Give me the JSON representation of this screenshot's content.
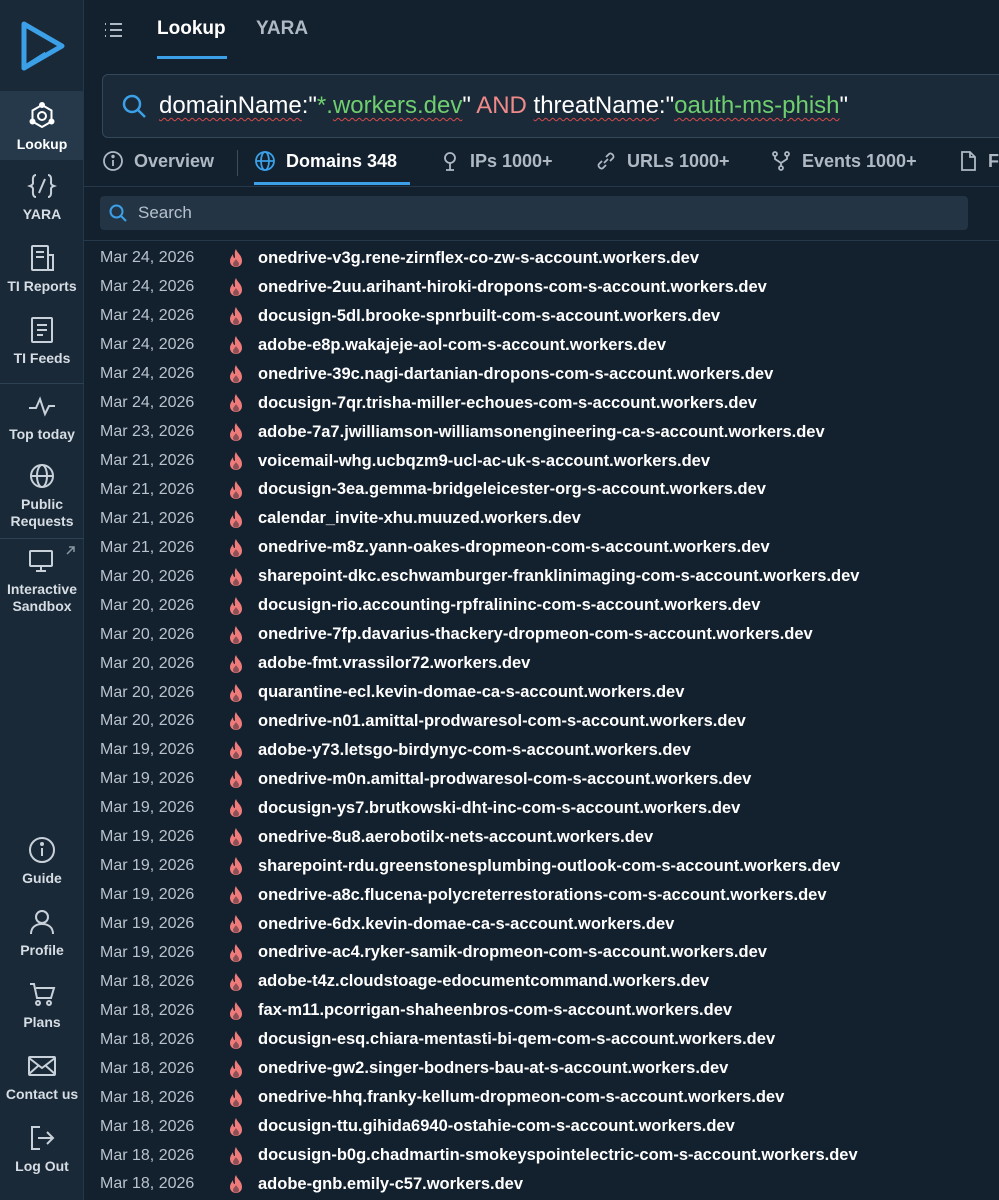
{
  "sidebar": {
    "items": [
      {
        "label": "Lookup",
        "icon": "network-hexagon-icon"
      },
      {
        "label": "YARA",
        "icon": "braces-icon"
      },
      {
        "label": "TI Reports",
        "icon": "report-icon"
      },
      {
        "label": "TI Feeds",
        "icon": "feed-icon"
      },
      {
        "label": "Top today",
        "icon": "pulse-icon"
      },
      {
        "label": "Public Requests",
        "icon": "globe-icon"
      },
      {
        "label": "Interactive Sandbox",
        "icon": "monitor-icon"
      }
    ],
    "bottom_items": [
      {
        "label": "Guide",
        "icon": "info-icon"
      },
      {
        "label": "Profile",
        "icon": "user-icon"
      },
      {
        "label": "Plans",
        "icon": "cart-icon"
      },
      {
        "label": "Contact us",
        "icon": "envelope-icon"
      },
      {
        "label": "Log Out",
        "icon": "logout-icon"
      }
    ]
  },
  "top_tabs": [
    {
      "label": "Lookup",
      "active": true
    },
    {
      "label": "YARA",
      "active": false
    }
  ],
  "query": {
    "field1": "domainName",
    "colon1": ":\"",
    "wildcard": "*.",
    "value1": "workers.dev",
    "close1": "\" ",
    "operator": "AND",
    "space": " ",
    "field2": "threatName",
    "colon2": ":\"",
    "value2": "oauth-ms-phish",
    "close2": "\""
  },
  "result_tabs": [
    {
      "label": "Overview",
      "icon": "info-circle-icon"
    },
    {
      "label": "Domains 348",
      "icon": "globe-icon",
      "active": true
    },
    {
      "label": "IPs 1000+",
      "icon": "location-pin-icon"
    },
    {
      "label": "URLs 1000+",
      "icon": "link-icon"
    },
    {
      "label": "Events 1000+",
      "icon": "fork-icon"
    },
    {
      "label": "F",
      "icon": "file-icon"
    }
  ],
  "search": {
    "placeholder": "Search"
  },
  "colors": {
    "accent": "#3ba0e8",
    "threat_flame": "#ef7b7b",
    "bg": "#13202d"
  },
  "rows": [
    {
      "date": "Mar 24, 2026",
      "domain": "onedrive-v3g.rene-zirnflex-co-zw-s-account.workers.dev"
    },
    {
      "date": "Mar 24, 2026",
      "domain": "onedrive-2uu.arihant-hiroki-dropons-com-s-account.workers.dev"
    },
    {
      "date": "Mar 24, 2026",
      "domain": "docusign-5dl.brooke-spnrbuilt-com-s-account.workers.dev"
    },
    {
      "date": "Mar 24, 2026",
      "domain": "adobe-e8p.wakajeje-aol-com-s-account.workers.dev"
    },
    {
      "date": "Mar 24, 2026",
      "domain": "onedrive-39c.nagi-dartanian-dropons-com-s-account.workers.dev"
    },
    {
      "date": "Mar 24, 2026",
      "domain": "docusign-7qr.trisha-miller-echoues-com-s-account.workers.dev"
    },
    {
      "date": "Mar 23, 2026",
      "domain": "adobe-7a7.jwilliamson-williamsonengineering-ca-s-account.workers.dev"
    },
    {
      "date": "Mar 21, 2026",
      "domain": "voicemail-whg.ucbqzm9-ucl-ac-uk-s-account.workers.dev"
    },
    {
      "date": "Mar 21, 2026",
      "domain": "docusign-3ea.gemma-bridgeleicester-org-s-account.workers.dev"
    },
    {
      "date": "Mar 21, 2026",
      "domain": "calendar_invite-xhu.muuzed.workers.dev"
    },
    {
      "date": "Mar 21, 2026",
      "domain": "onedrive-m8z.yann-oakes-dropmeon-com-s-account.workers.dev"
    },
    {
      "date": "Mar 20, 2026",
      "domain": "sharepoint-dkc.eschwamburger-franklinimaging-com-s-account.workers.dev"
    },
    {
      "date": "Mar 20, 2026",
      "domain": "docusign-rio.accounting-rpfralininc-com-s-account.workers.dev"
    },
    {
      "date": "Mar 20, 2026",
      "domain": "onedrive-7fp.davarius-thackery-dropmeon-com-s-account.workers.dev"
    },
    {
      "date": "Mar 20, 2026",
      "domain": "adobe-fmt.vrassilor72.workers.dev"
    },
    {
      "date": "Mar 20, 2026",
      "domain": "quarantine-ecl.kevin-domae-ca-s-account.workers.dev"
    },
    {
      "date": "Mar 20, 2026",
      "domain": "onedrive-n01.amittal-prodwaresol-com-s-account.workers.dev"
    },
    {
      "date": "Mar 19, 2026",
      "domain": "adobe-y73.letsgo-birdynyc-com-s-account.workers.dev"
    },
    {
      "date": "Mar 19, 2026",
      "domain": "onedrive-m0n.amittal-prodwaresol-com-s-account.workers.dev"
    },
    {
      "date": "Mar 19, 2026",
      "domain": "docusign-ys7.brutkowski-dht-inc-com-s-account.workers.dev"
    },
    {
      "date": "Mar 19, 2026",
      "domain": "onedrive-8u8.aerobotilx-nets-account.workers.dev"
    },
    {
      "date": "Mar 19, 2026",
      "domain": "sharepoint-rdu.greenstonesplumbing-outlook-com-s-account.workers.dev"
    },
    {
      "date": "Mar 19, 2026",
      "domain": "onedrive-a8c.flucena-polycreterrestorations-com-s-account.workers.dev"
    },
    {
      "date": "Mar 19, 2026",
      "domain": "onedrive-6dx.kevin-domae-ca-s-account.workers.dev"
    },
    {
      "date": "Mar 19, 2026",
      "domain": "onedrive-ac4.ryker-samik-dropmeon-com-s-account.workers.dev"
    },
    {
      "date": "Mar 18, 2026",
      "domain": "adobe-t4z.cloudstoage-edocumentcommand.workers.dev"
    },
    {
      "date": "Mar 18, 2026",
      "domain": "fax-m11.pcorrigan-shaheenbros-com-s-account.workers.dev"
    },
    {
      "date": "Mar 18, 2026",
      "domain": "docusign-esq.chiara-mentasti-bi-qem-com-s-account.workers.dev"
    },
    {
      "date": "Mar 18, 2026",
      "domain": "onedrive-gw2.singer-bodners-bau-at-s-account.workers.dev"
    },
    {
      "date": "Mar 18, 2026",
      "domain": "onedrive-hhq.franky-kellum-dropmeon-com-s-account.workers.dev"
    },
    {
      "date": "Mar 18, 2026",
      "domain": "docusign-ttu.gihida6940-ostahie-com-s-account.workers.dev"
    },
    {
      "date": "Mar 18, 2026",
      "domain": "docusign-b0g.chadmartin-smokeyspointelectric-com-s-account.workers.dev"
    },
    {
      "date": "Mar 18, 2026",
      "domain": "adobe-gnb.emily-c57.workers.dev"
    }
  ]
}
